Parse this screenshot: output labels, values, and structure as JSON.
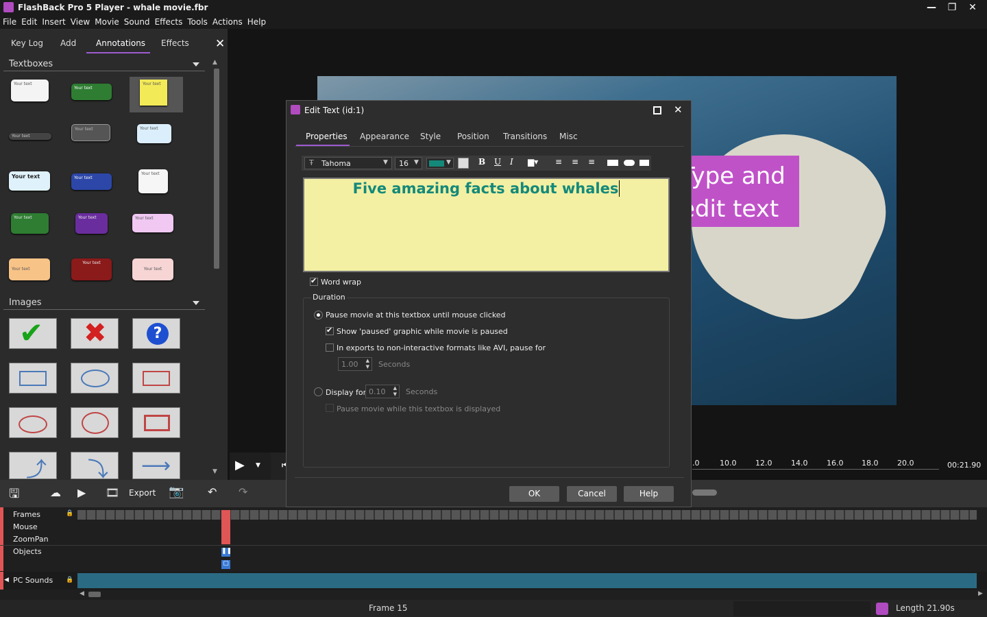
{
  "window": {
    "title": "FlashBack Pro 5 Player - whale movie.fbr"
  },
  "menu": [
    "File",
    "Edit",
    "Insert",
    "View",
    "Movie",
    "Sound",
    "Effects",
    "Tools",
    "Actions",
    "Help"
  ],
  "panel": {
    "tabs": [
      "Key Log",
      "Add",
      "Annotations",
      "Effects"
    ],
    "textboxes_title": "Textboxes",
    "images_title": "Images",
    "tb_small": "Your text",
    "tb_large": "Your text"
  },
  "dialog": {
    "title": "Edit Text (id:1)",
    "tabs": [
      "Properties",
      "Appearance",
      "Style",
      "Position",
      "Transitions",
      "Misc"
    ],
    "font": "Tahoma",
    "size": "16",
    "text": "Five amazing facts about whales",
    "word_wrap": "Word wrap",
    "duration": "Duration",
    "opt_pause": "Pause movie at this textbox until mouse clicked",
    "opt_show": "Show 'paused' graphic while movie is paused",
    "opt_exports": "In exports to non-interactive formats like AVI, pause for",
    "exports_val": "1.00",
    "seconds1": "Seconds",
    "opt_display": "Display for",
    "display_val": "0.10",
    "seconds2": "Seconds",
    "opt_pause_disp": "Pause movie while this textbox is displayed",
    "ok": "OK",
    "cancel": "Cancel",
    "help": "Help"
  },
  "callout": {
    "line1": "Type and",
    "line2": "edit text"
  },
  "ruler": {
    "ticks": [
      ".0",
      "10.0",
      "12.0",
      "14.0",
      "16.0",
      "18.0",
      "20.0"
    ],
    "time": "00:21.90"
  },
  "toolbar": {
    "export": "Export"
  },
  "timeline": {
    "rows": [
      "Frames",
      "Mouse",
      "ZoomPan",
      "Objects"
    ],
    "sounds": "PC Sounds"
  },
  "status": {
    "frame": "Frame 15",
    "length": "Length 21.90s"
  },
  "colors": {
    "accent": "#9d5cd0",
    "callout": "#c052c8",
    "editor_bg": "#f3f0a3",
    "text_color": "#14897a"
  }
}
